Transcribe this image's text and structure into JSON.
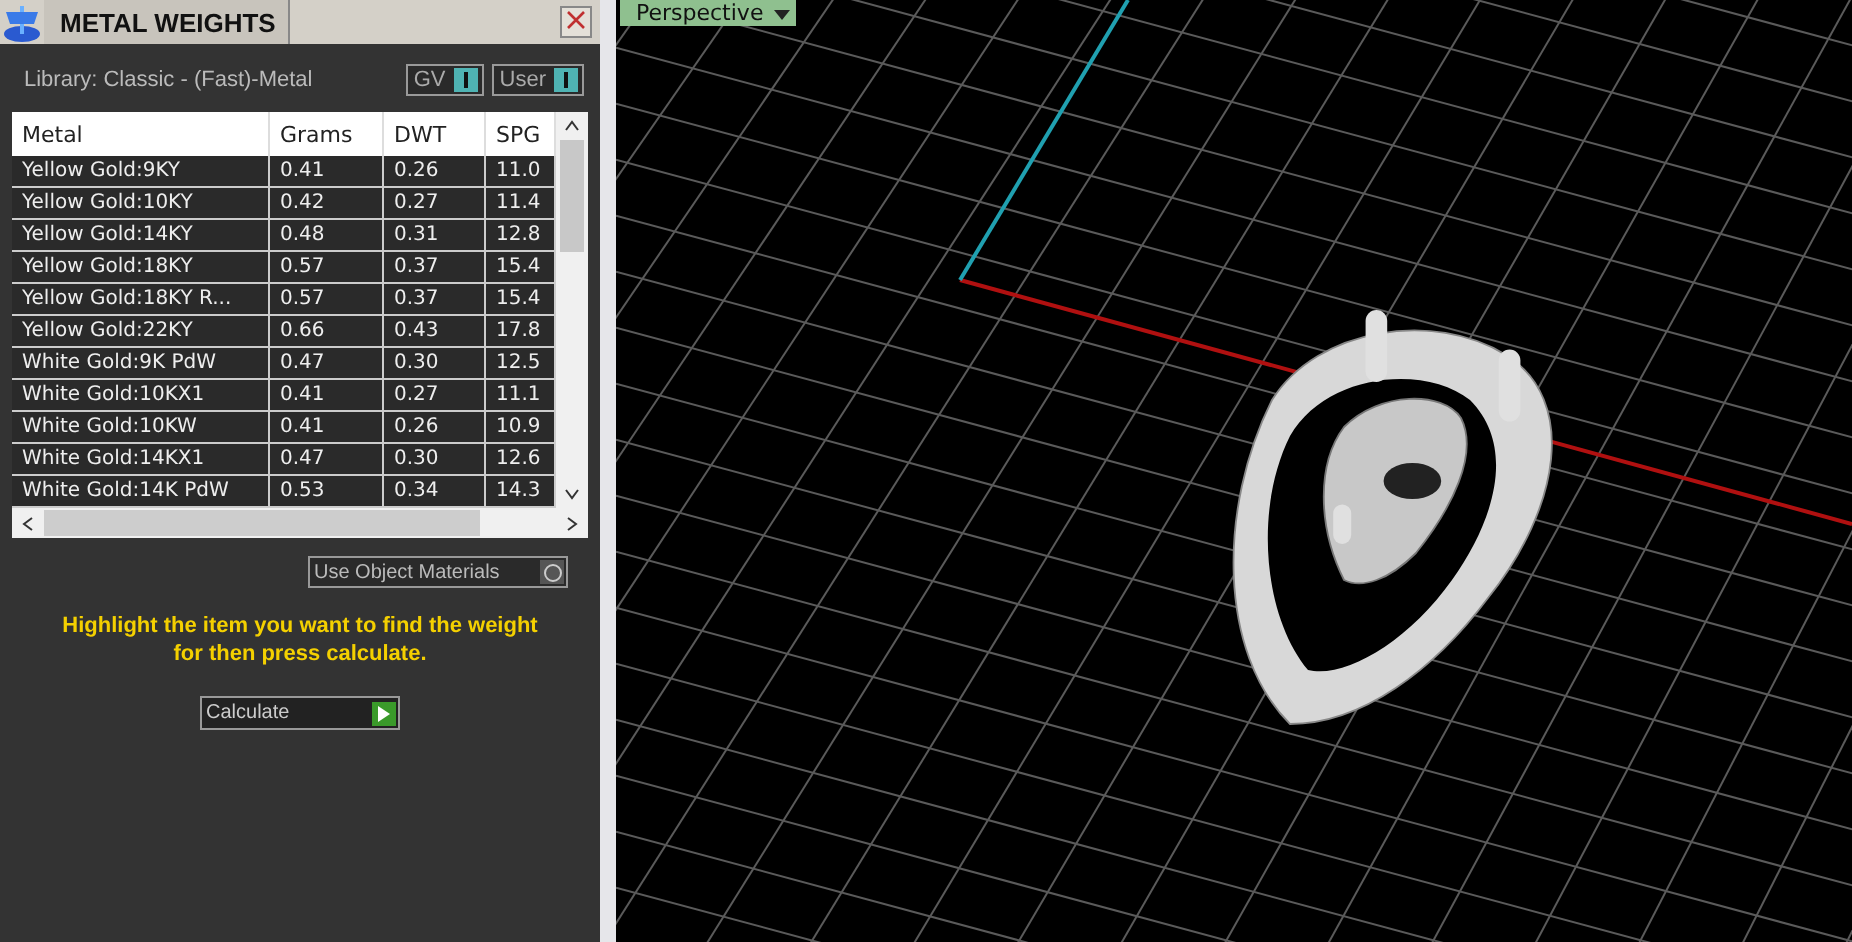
{
  "panel": {
    "title": "METAL WEIGHTS",
    "library": "Library: Classic - (Fast)-Metal",
    "toggles": [
      {
        "label": "GV",
        "on": true
      },
      {
        "label": "User",
        "on": true
      }
    ],
    "table": {
      "columns": [
        "Metal",
        "Grams",
        "DWT",
        "SPG"
      ],
      "rows": [
        [
          "Yellow Gold:9KY",
          "0.41",
          "0.26",
          "11.0"
        ],
        [
          "Yellow Gold:10KY",
          "0.42",
          "0.27",
          "11.4"
        ],
        [
          "Yellow Gold:14KY",
          "0.48",
          "0.31",
          "12.8"
        ],
        [
          "Yellow Gold:18KY",
          "0.57",
          "0.37",
          "15.4"
        ],
        [
          "Yellow Gold:18KY R...",
          "0.57",
          "0.37",
          "15.4"
        ],
        [
          "Yellow Gold:22KY",
          "0.66",
          "0.43",
          "17.8"
        ],
        [
          "White Gold:9K PdW",
          "0.47",
          "0.30",
          "12.5"
        ],
        [
          "White Gold:10KX1",
          "0.41",
          "0.27",
          "11.1"
        ],
        [
          "White Gold:10KW",
          "0.41",
          "0.26",
          "10.9"
        ],
        [
          "White Gold:14KX1",
          "0.47",
          "0.30",
          "12.6"
        ],
        [
          "White Gold:14K PdW",
          "0.53",
          "0.34",
          "14.3"
        ]
      ]
    },
    "use_object_materials": {
      "label": "Use Object Materials",
      "on": false
    },
    "hint": "Highlight the item you want to find the weight for then press calculate.",
    "calculate": "Calculate"
  },
  "viewport": {
    "view": "Perspective"
  }
}
